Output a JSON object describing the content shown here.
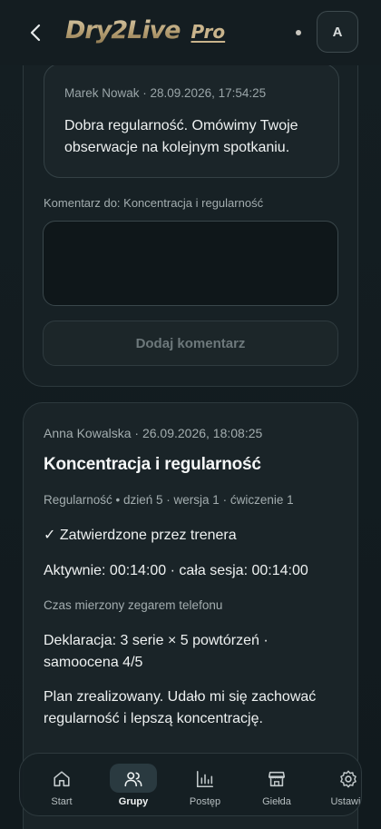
{
  "header": {
    "logo_main": "Dry2Live",
    "logo_pro": "Pro",
    "avatar_letter": "A"
  },
  "comment": {
    "author_meta": "Marek Nowak · 28.09.2026, 17:54:25",
    "text": "Dobra regularność. Omówimy Twoje obserwacje na kolejnym spotkaniu."
  },
  "comment_form": {
    "label": "Komentarz do: Koncentracja i regularność",
    "input_value": "",
    "button_label": "Dodaj komentarz"
  },
  "entry": {
    "meta": "Anna Kowalska · 26.09.2026, 18:08:25",
    "title": "Koncentracja i regularność",
    "tags": "Regularność • dzień 5 · wersja 1 · ćwiczenie 1",
    "approved": "✓ Zatwierdzone przez trenera",
    "active_time": "Aktywnie: 00:14:00 · cała sesja: 00:14:00",
    "clock_note": "Czas mierzony zegarem telefonu",
    "declaration": "Deklaracja: 3 serie × 5 powtórzeń · samoocena 4/5",
    "note": "Plan zrealizowany. Udało mi się zachować regularność i lepszą koncentrację."
  },
  "nav": {
    "items": [
      {
        "label": "Start",
        "icon": "home-icon"
      },
      {
        "label": "Grupy",
        "icon": "users-icon",
        "active": true
      },
      {
        "label": "Postęp",
        "icon": "chart-icon"
      },
      {
        "label": "Giełda",
        "icon": "store-icon"
      },
      {
        "label": "Ustawie",
        "icon": "settings-icon"
      }
    ]
  },
  "colors": {
    "background": "#121c20",
    "accent_gold": "#c9b48c"
  }
}
